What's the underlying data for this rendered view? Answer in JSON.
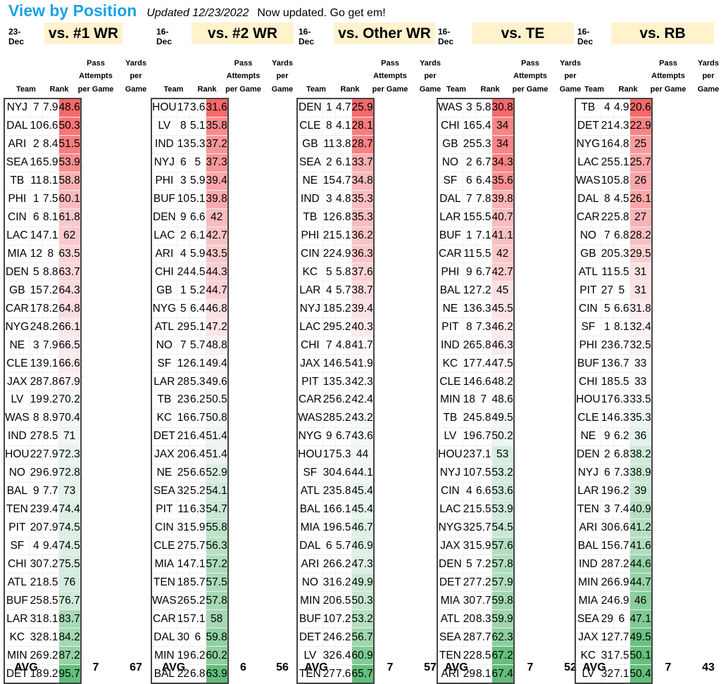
{
  "header": {
    "title": "View by Position",
    "updated": "Updated 12/23/2022",
    "note": "Now updated. Go get em!"
  },
  "column_headers": {
    "team": "Team",
    "rank": "Rank",
    "pass_l1": "Pass",
    "pass_l2": "Attempts",
    "pass_l3": "per Game",
    "yards_l1": "Yards",
    "yards_l2": "per",
    "yards_l3": "Game"
  },
  "avg_label": "AVG",
  "colors": {
    "low": "#f8696b",
    "mid": "#fcfcff",
    "high": "#63be7b",
    "title": "#1da1e6",
    "position_header_bg": "#fff2cc"
  },
  "tables": [
    {
      "date": "23-Dec",
      "position": "vs. #1 WR",
      "avg_pass": "7",
      "avg_yards": "67",
      "rows": [
        [
          "NYJ",
          "7",
          "7.9",
          "48.6"
        ],
        [
          "DAL",
          "10",
          "6.6",
          "50.3"
        ],
        [
          "ARI",
          "2",
          "8.4",
          "51.5"
        ],
        [
          "SEA",
          "16",
          "5.9",
          "53.9"
        ],
        [
          "TB",
          "11",
          "8.1",
          "58.8"
        ],
        [
          "PHI",
          "1",
          "7.5",
          "60.1"
        ],
        [
          "CIN",
          "6",
          "8.1",
          "61.8"
        ],
        [
          "LAC",
          "14",
          "7.1",
          "62"
        ],
        [
          "MIA",
          "12",
          "8",
          "63.5"
        ],
        [
          "DEN",
          "5",
          "8.8",
          "63.7"
        ],
        [
          "GB",
          "15",
          "7.2",
          "64.3"
        ],
        [
          "CAR",
          "17",
          "8.2",
          "64.8"
        ],
        [
          "NYG",
          "24",
          "8.2",
          "66.1"
        ],
        [
          "NE",
          "3",
          "7.9",
          "66.5"
        ],
        [
          "CLE",
          "13",
          "9.1",
          "66.6"
        ],
        [
          "JAX",
          "28",
          "7.8",
          "67.9"
        ],
        [
          "LV",
          "19",
          "9.2",
          "70.2"
        ],
        [
          "WAS",
          "8",
          "8.9",
          "70.4"
        ],
        [
          "IND",
          "27",
          "8.5",
          "71"
        ],
        [
          "HOU",
          "22",
          "7.9",
          "72.3"
        ],
        [
          "NO",
          "29",
          "6.9",
          "72.8"
        ],
        [
          "BAL",
          "9",
          "7.7",
          "73"
        ],
        [
          "TEN",
          "23",
          "9.4",
          "74.4"
        ],
        [
          "PIT",
          "20",
          "7.9",
          "74.5"
        ],
        [
          "SF",
          "4",
          "9.4",
          "74.5"
        ],
        [
          "CHI",
          "30",
          "7.2",
          "75.5"
        ],
        [
          "ATL",
          "21",
          "8.5",
          "76"
        ],
        [
          "BUF",
          "25",
          "8.5",
          "76.7"
        ],
        [
          "LAR",
          "31",
          "8.1",
          "83.7"
        ],
        [
          "KC",
          "32",
          "8.1",
          "84.2"
        ],
        [
          "MIN",
          "26",
          "9.2",
          "87.2"
        ],
        [
          "DET",
          "18",
          "9.2",
          "95.7"
        ]
      ]
    },
    {
      "date": "16-Dec",
      "position": "vs. #2 WR",
      "avg_pass": "6",
      "avg_yards": "56",
      "rows": [
        [
          "HOU",
          "17",
          "3.6",
          "31.6"
        ],
        [
          "LV",
          "8",
          "5.1",
          "35.8"
        ],
        [
          "IND",
          "13",
          "5.3",
          "37.2"
        ],
        [
          "NYJ",
          "6",
          "5",
          "37.3"
        ],
        [
          "PHI",
          "3",
          "5.9",
          "39.4"
        ],
        [
          "BUF",
          "10",
          "5.1",
          "39.8"
        ],
        [
          "DEN",
          "9",
          "6.6",
          "42"
        ],
        [
          "LAC",
          "2",
          "6.1",
          "42.7"
        ],
        [
          "ARI",
          "4",
          "5.9",
          "43.5"
        ],
        [
          "CHI",
          "24",
          "4.5",
          "44.3"
        ],
        [
          "GB",
          "1",
          "5.2",
          "44.7"
        ],
        [
          "NYG",
          "5",
          "6.4",
          "46.8"
        ],
        [
          "ATL",
          "29",
          "5.1",
          "47.2"
        ],
        [
          "NO",
          "7",
          "5.7",
          "48.8"
        ],
        [
          "SF",
          "12",
          "6.1",
          "49.4"
        ],
        [
          "LAR",
          "28",
          "5.3",
          "49.6"
        ],
        [
          "TB",
          "23",
          "6.2",
          "50.5"
        ],
        [
          "KC",
          "16",
          "6.7",
          "50.8"
        ],
        [
          "DET",
          "21",
          "6.4",
          "51.4"
        ],
        [
          "JAX",
          "20",
          "6.4",
          "51.4"
        ],
        [
          "NE",
          "25",
          "6.6",
          "52.9"
        ],
        [
          "SEA",
          "32",
          "5.2",
          "54.1"
        ],
        [
          "PIT",
          "11",
          "6.3",
          "54.7"
        ],
        [
          "CIN",
          "31",
          "5.9",
          "55.8"
        ],
        [
          "CLE",
          "27",
          "5.7",
          "56.3"
        ],
        [
          "MIA",
          "14",
          "7.1",
          "57.2"
        ],
        [
          "TEN",
          "18",
          "5.7",
          "57.5"
        ],
        [
          "WAS",
          "26",
          "5.2",
          "57.8"
        ],
        [
          "CAR",
          "15",
          "7.1",
          "58"
        ],
        [
          "DAL",
          "30",
          "6",
          "59.8"
        ],
        [
          "MIN",
          "19",
          "6.2",
          "60.2"
        ],
        [
          "BAL",
          "22",
          "6.8",
          "63.9"
        ]
      ]
    },
    {
      "date": "16-Dec",
      "position": "vs. Other WR",
      "avg_pass": "7",
      "avg_yards": "57",
      "rows": [
        [
          "DEN",
          "1",
          "4.7",
          "25.9"
        ],
        [
          "CLE",
          "8",
          "4.1",
          "28.1"
        ],
        [
          "GB",
          "11",
          "3.8",
          "28.7"
        ],
        [
          "SEA",
          "2",
          "6.1",
          "33.7"
        ],
        [
          "NE",
          "15",
          "4.7",
          "34.8"
        ],
        [
          "IND",
          "3",
          "4.8",
          "35.3"
        ],
        [
          "TB",
          "12",
          "6.8",
          "35.3"
        ],
        [
          "PHI",
          "21",
          "5.1",
          "36.2"
        ],
        [
          "CIN",
          "22",
          "4.9",
          "36.3"
        ],
        [
          "KC",
          "5",
          "5.8",
          "37.6"
        ],
        [
          "LAR",
          "4",
          "5.7",
          "38.7"
        ],
        [
          "NYJ",
          "18",
          "5.2",
          "39.4"
        ],
        [
          "LAC",
          "29",
          "5.2",
          "40.3"
        ],
        [
          "CHI",
          "7",
          "4.8",
          "41.7"
        ],
        [
          "JAX",
          "14",
          "6.5",
          "41.9"
        ],
        [
          "PIT",
          "13",
          "5.3",
          "42.3"
        ],
        [
          "CAR",
          "25",
          "6.2",
          "42.4"
        ],
        [
          "WAS",
          "28",
          "5.2",
          "43.2"
        ],
        [
          "NYG",
          "9",
          "6.7",
          "43.6"
        ],
        [
          "HOU",
          "17",
          "5.3",
          "44"
        ],
        [
          "SF",
          "30",
          "4.6",
          "44.1"
        ],
        [
          "ATL",
          "23",
          "5.8",
          "45.4"
        ],
        [
          "BAL",
          "16",
          "6.1",
          "45.4"
        ],
        [
          "MIA",
          "19",
          "6.5",
          "46.7"
        ],
        [
          "DAL",
          "6",
          "5.7",
          "46.9"
        ],
        [
          "ARI",
          "26",
          "6.2",
          "47.3"
        ],
        [
          "NO",
          "31",
          "6.2",
          "49.9"
        ],
        [
          "MIN",
          "20",
          "6.5",
          "50.3"
        ],
        [
          "BUF",
          "10",
          "7.2",
          "53.2"
        ],
        [
          "DET",
          "24",
          "6.2",
          "56.7"
        ],
        [
          "LV",
          "32",
          "6.4",
          "60.9"
        ],
        [
          "TEN",
          "27",
          "7.6",
          "65.7"
        ]
      ]
    },
    {
      "date": "16-Dec",
      "position": "vs. TE",
      "avg_pass": "7",
      "avg_yards": "52",
      "rows": [
        [
          "WAS",
          "3",
          "5.8",
          "30.8"
        ],
        [
          "CHI",
          "16",
          "5.4",
          "34"
        ],
        [
          "GB",
          "25",
          "5.3",
          "34"
        ],
        [
          "NO",
          "2",
          "6.7",
          "34.3"
        ],
        [
          "SF",
          "6",
          "6.4",
          "35.6"
        ],
        [
          "DAL",
          "7",
          "7.8",
          "39.8"
        ],
        [
          "LAR",
          "15",
          "5.5",
          "40.7"
        ],
        [
          "BUF",
          "1",
          "7.1",
          "41.1"
        ],
        [
          "CAR",
          "11",
          "5.5",
          "42"
        ],
        [
          "PHI",
          "9",
          "6.7",
          "42.7"
        ],
        [
          "BAL",
          "12",
          "7.2",
          "45"
        ],
        [
          "NE",
          "13",
          "6.3",
          "45.5"
        ],
        [
          "PIT",
          "8",
          "7.3",
          "46.2"
        ],
        [
          "IND",
          "26",
          "5.8",
          "46.3"
        ],
        [
          "KC",
          "17",
          "7.4",
          "47.5"
        ],
        [
          "CLE",
          "14",
          "6.6",
          "48.2"
        ],
        [
          "MIN",
          "18",
          "7",
          "48.6"
        ],
        [
          "TB",
          "24",
          "5.8",
          "49.5"
        ],
        [
          "LV",
          "19",
          "6.7",
          "50.2"
        ],
        [
          "HOU",
          "23",
          "7.1",
          "53"
        ],
        [
          "NYJ",
          "10",
          "7.5",
          "53.2"
        ],
        [
          "CIN",
          "4",
          "6.6",
          "53.6"
        ],
        [
          "LAC",
          "21",
          "5.5",
          "53.9"
        ],
        [
          "NYG",
          "32",
          "5.7",
          "54.5"
        ],
        [
          "JAX",
          "31",
          "5.9",
          "57.6"
        ],
        [
          "DEN",
          "5",
          "7.2",
          "57.8"
        ],
        [
          "DET",
          "27",
          "7.2",
          "57.9"
        ],
        [
          "MIA",
          "30",
          "7.7",
          "59.8"
        ],
        [
          "ATL",
          "20",
          "8.3",
          "59.9"
        ],
        [
          "SEA",
          "28",
          "7.7",
          "62.3"
        ],
        [
          "TEN",
          "22",
          "8.5",
          "67.2"
        ],
        [
          "ARI",
          "29",
          "8.1",
          "67.4"
        ]
      ]
    },
    {
      "date": "16-Dec",
      "position": "vs. RB",
      "avg_pass": "7",
      "avg_yards": "43",
      "rows": [
        [
          "TB",
          "4",
          "4.9",
          "20.6"
        ],
        [
          "DET",
          "21",
          "4.3",
          "22.9"
        ],
        [
          "NYG",
          "16",
          "4.8",
          "25"
        ],
        [
          "LAC",
          "25",
          "5.1",
          "25.7"
        ],
        [
          "WAS",
          "10",
          "5.8",
          "26"
        ],
        [
          "DAL",
          "8",
          "4.5",
          "26.1"
        ],
        [
          "CAR",
          "22",
          "5.8",
          "27"
        ],
        [
          "NO",
          "7",
          "6.8",
          "28.2"
        ],
        [
          "GB",
          "20",
          "5.3",
          "29.5"
        ],
        [
          "ATL",
          "11",
          "5.5",
          "31"
        ],
        [
          "PIT",
          "27",
          "5",
          "31"
        ],
        [
          "CIN",
          "5",
          "6.6",
          "31.8"
        ],
        [
          "SF",
          "1",
          "8.1",
          "32.4"
        ],
        [
          "PHI",
          "23",
          "6.7",
          "32.5"
        ],
        [
          "BUF",
          "13",
          "6.7",
          "33"
        ],
        [
          "CHI",
          "18",
          "5.5",
          "33"
        ],
        [
          "HOU",
          "17",
          "6.3",
          "33.5"
        ],
        [
          "CLE",
          "14",
          "6.3",
          "35.3"
        ],
        [
          "NE",
          "9",
          "6.2",
          "36"
        ],
        [
          "DEN",
          "2",
          "6.8",
          "38.2"
        ],
        [
          "NYJ",
          "6",
          "7.3",
          "38.9"
        ],
        [
          "LAR",
          "19",
          "6.2",
          "39"
        ],
        [
          "TEN",
          "3",
          "7.4",
          "40.9"
        ],
        [
          "ARI",
          "30",
          "6.6",
          "41.2"
        ],
        [
          "BAL",
          "15",
          "6.7",
          "41.6"
        ],
        [
          "IND",
          "28",
          "7.2",
          "44.6"
        ],
        [
          "MIN",
          "26",
          "6.9",
          "44.7"
        ],
        [
          "MIA",
          "24",
          "6.9",
          "46"
        ],
        [
          "SEA",
          "29",
          "6",
          "47.1"
        ],
        [
          "JAX",
          "12",
          "7.7",
          "49.5"
        ],
        [
          "KC",
          "31",
          "7.5",
          "50.1"
        ],
        [
          "LV",
          "32",
          "7.1",
          "50.4"
        ]
      ]
    }
  ]
}
